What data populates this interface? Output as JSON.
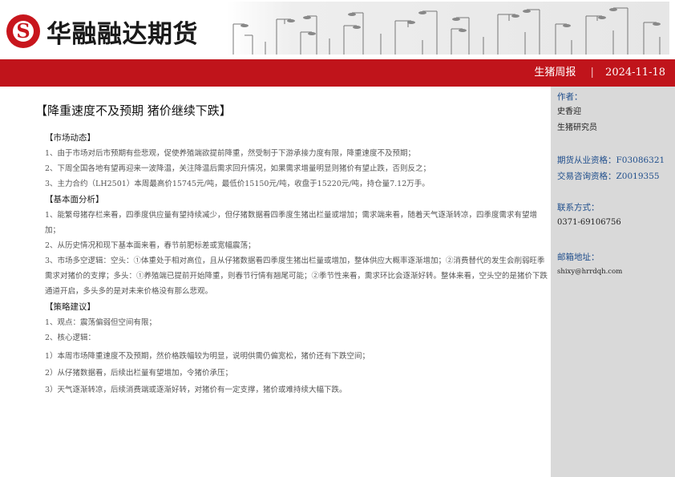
{
  "header": {
    "logo_glyph": "S",
    "company_name": "华融融达期货",
    "report_type": "生猪周报",
    "separator": "|",
    "date": "2024-11-18"
  },
  "colors": {
    "brand_red": "#c0141b",
    "sidebar_bg": "#d9d9d9",
    "label_blue": "#1f4e8c"
  },
  "sidebar": {
    "author_label": "作者：",
    "author_name": "史香迎",
    "author_dept": "生猪研究员",
    "futures_license": "期货从业资格：F03086321",
    "consult_license": "交易咨询资格：Z0019355",
    "contact_label": "联系方式：",
    "phone": "0371-69106756",
    "email_label": "邮箱地址：",
    "email": "shixy@hrrdqh.com"
  },
  "main": {
    "title": "【降重速度不及预期 猪价继续下跌】",
    "sections": [
      {
        "heading": "【市场动态】",
        "paragraphs": [
          "1、由于市场对后市预期有些悲观，促使养殖端欲提前降重，然受制于下游承接力度有限，降重速度不及预期；",
          "2、下周全国各地有望再迎来一波降温，关注降温后需求回升情况，如果需求增量明显则猪价有望止跌，否则反之；",
          "3、主力合约（LH2501）本周最高价15745元/吨，最低价15150元/吨，收盘于15220元/吨，持仓量7.12万手。"
        ]
      },
      {
        "heading": "【基本面分析】",
        "paragraphs": [
          "1、能繁母猪存栏来看，四季度供应量有望持续减少，但仔猪数据看四季度生猪出栏量或增加；需求端来看，随着天气逐渐转凉，四季度需求有望增加；",
          "2、从历史情况和现下基本面来看，春节前肥标差或宽幅震荡；",
          "3、市场多空逻辑：空头：①体重处于相对高位，且从仔猪数据看四季度生猪出栏量或增加，整体供应大概率逐渐增加；②消费替代的发生会削弱旺季需求对猪价的支撑；多头：①养殖端已提前开始降重，则春节行情有翘尾可能；②季节性来看，需求环比会逐渐好转。整体来看，空头空的是猪价下跌通道开启，多头多的是对未来价格没有那么悲观。"
        ]
      },
      {
        "heading": "【策略建议】",
        "paragraphs": [
          "1、观点：震荡偏弱但空间有限；",
          "2、核心逻辑：",
          "1）本周市场降重速度不及预期，然价格跌幅较为明显，说明供需仍偏宽松，猪价还有下跌空间；",
          "2）从仔猪数据看，后续出栏量有望增加，令猪价承压；",
          "3）天气逐渐转凉，后续消费端或逐渐好转，对猪价有一定支撑，猪价或难持续大幅下跌。"
        ]
      }
    ]
  }
}
